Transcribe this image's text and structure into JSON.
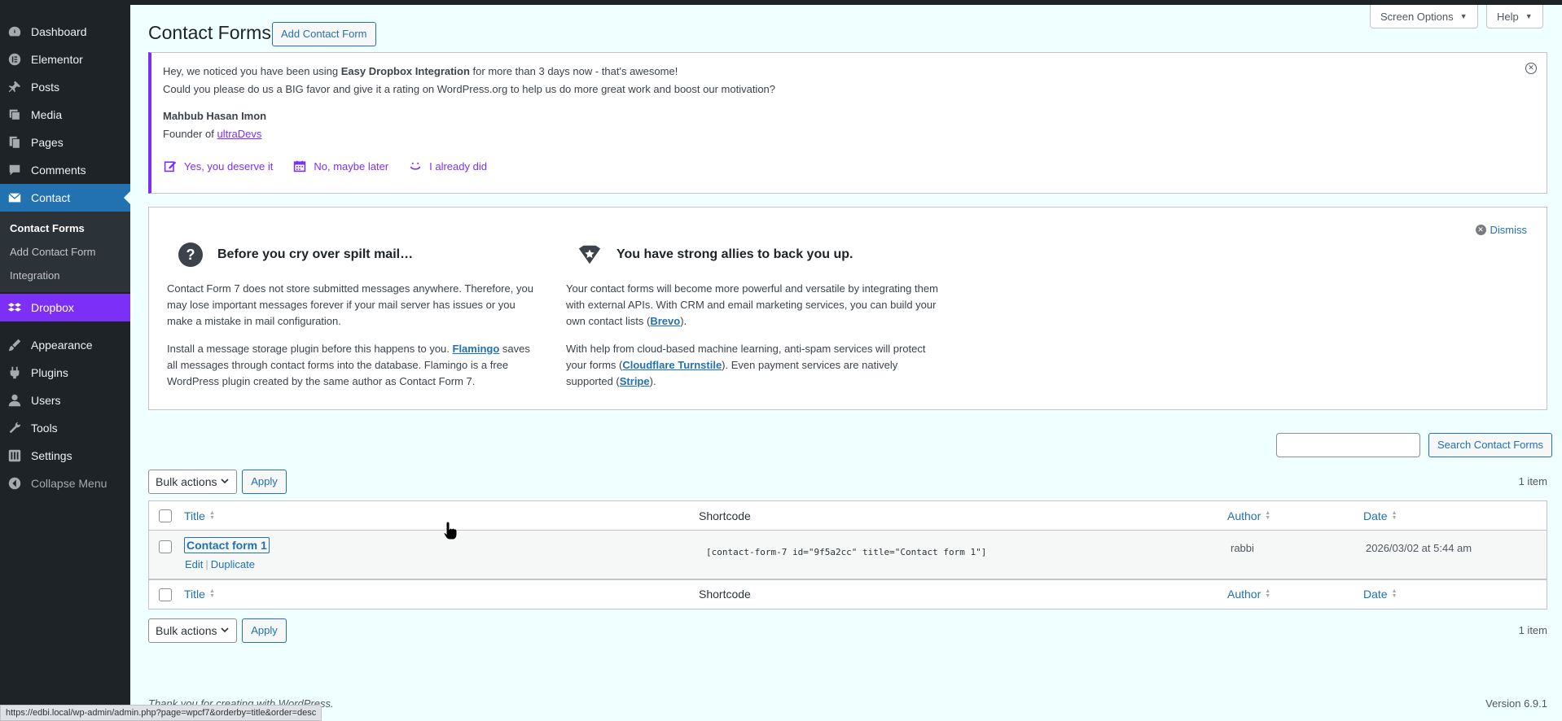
{
  "sidebar": {
    "items": [
      {
        "label": "Dashboard",
        "icon": "dashboard-icon"
      },
      {
        "label": "Elementor",
        "icon": "elementor-icon"
      },
      {
        "label": "Posts",
        "icon": "pushpin-icon"
      },
      {
        "label": "Media",
        "icon": "media-icon"
      },
      {
        "label": "Pages",
        "icon": "pages-icon"
      },
      {
        "label": "Comments",
        "icon": "comment-icon"
      },
      {
        "label": "Contact",
        "icon": "envelope-icon"
      }
    ],
    "submenu": [
      "Contact Forms",
      "Add Contact Form",
      "Integration"
    ],
    "dropbox": {
      "label": "Dropbox",
      "icon": "dropbox-icon"
    },
    "items2": [
      {
        "label": "Appearance",
        "icon": "brush-icon"
      },
      {
        "label": "Plugins",
        "icon": "plugin-icon"
      },
      {
        "label": "Users",
        "icon": "user-icon"
      },
      {
        "label": "Tools",
        "icon": "wrench-icon"
      },
      {
        "label": "Settings",
        "icon": "settings-icon"
      }
    ],
    "collapse": "Collapse Menu"
  },
  "header": {
    "title": "Contact Forms",
    "add_button": "Add Contact Form",
    "screen_options": "Screen Options",
    "help": "Help"
  },
  "notice": {
    "line1_pre": "Hey, we noticed you have been using ",
    "line1_bold": "Easy Dropbox Integration",
    "line1_post": " for more than 3 days now - that's awesome!",
    "line2": "Could you please do us a BIG favor and give it a rating on WordPress.org to help us do more great work and boost our motivation?",
    "author": "Mahbub Hasan Imon",
    "founder_pre": "Founder of ",
    "founder_link": "ultraDevs",
    "actions": [
      "Yes, you deserve it",
      "No, maybe later",
      "I already did"
    ]
  },
  "welcome": {
    "dismiss": "Dismiss",
    "col1": {
      "heading": "Before you cry over spilt mail…",
      "p1": "Contact Form 7 does not store submitted messages anywhere. Therefore, you may lose important messages forever if your mail server has issues or you make a mistake in mail configuration.",
      "p2_pre": "Install a message storage plugin before this happens to you. ",
      "p2_link": "Flamingo",
      "p2_post": " saves all messages through contact forms into the database. Flamingo is a free WordPress plugin created by the same author as Contact Form 7."
    },
    "col2": {
      "heading": "You have strong allies to back you up.",
      "p1_pre": "Your contact forms will become more powerful and versatile by integrating them with external APIs. With CRM and email marketing services, you can build your own contact lists (",
      "p1_link": "Brevo",
      "p1_post": ").",
      "p2_pre": "With help from cloud-based machine learning, anti-spam services will protect your forms (",
      "p2_link": "Cloudflare Turnstile",
      "p2_mid": "). Even payment services are natively supported (",
      "p2_link2": "Stripe",
      "p2_post": ")."
    }
  },
  "search": {
    "button": "Search Contact Forms",
    "value": ""
  },
  "bulk": {
    "label": "Bulk actions",
    "apply": "Apply",
    "count": "1 item"
  },
  "table": {
    "columns": [
      "Title",
      "Shortcode",
      "Author",
      "Date"
    ],
    "rows": [
      {
        "title": "Contact form 1",
        "edit": "Edit",
        "duplicate": "Duplicate",
        "shortcode": "[contact-form-7 id=\"9f5a2cc\" title=\"Contact form 1\"]",
        "author": "rabbi",
        "date": "2026/03/02 at 5:44 am"
      }
    ]
  },
  "footer": {
    "thanks": "Thank you for creating with WordPress.",
    "version": "Version 6.9.1"
  },
  "statusbar": "https://edbi.local/wp-admin/admin.php?page=wpcf7&orderby=title&order=desc"
}
